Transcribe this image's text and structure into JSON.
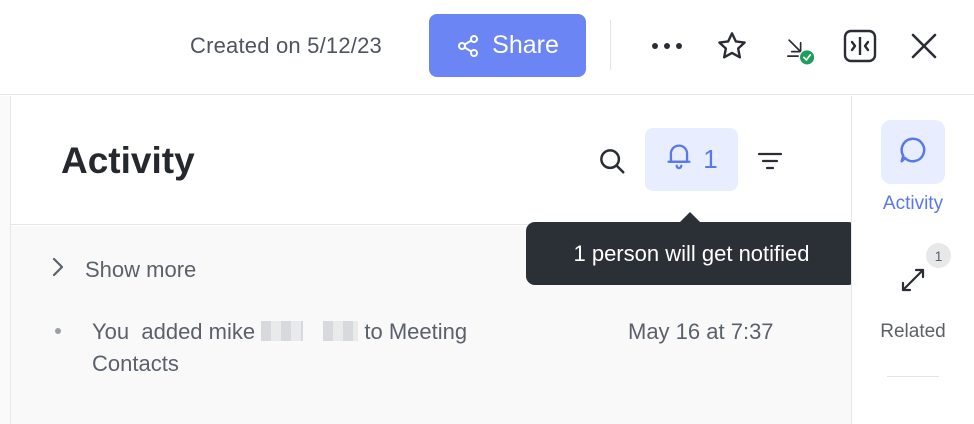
{
  "topbar": {
    "created_text": "Created on 5/12/23",
    "share_label": "Share",
    "icons": [
      "more-icon",
      "star-icon",
      "download-done-icon",
      "collapse-panel-icon",
      "close-icon"
    ],
    "accent_color": "#6b86f4",
    "success_color": "#1e9e5a"
  },
  "activity_panel": {
    "title": "Activity",
    "notify_count": "1",
    "show_more_label": "Show more",
    "entries": [
      {
        "actor": "You",
        "action_prefix": "added mike",
        "action_suffix": "to Meeting Contacts",
        "timestamp": "May 16 at 7:37"
      }
    ]
  },
  "tooltip": {
    "text": "1 person will get notified"
  },
  "right_rail": {
    "items": [
      {
        "label": "Activity",
        "icon": "chat-bubble-icon",
        "active": true
      },
      {
        "label": "Related",
        "icon": "arrows-icon",
        "badge": "1",
        "active": false
      }
    ]
  }
}
